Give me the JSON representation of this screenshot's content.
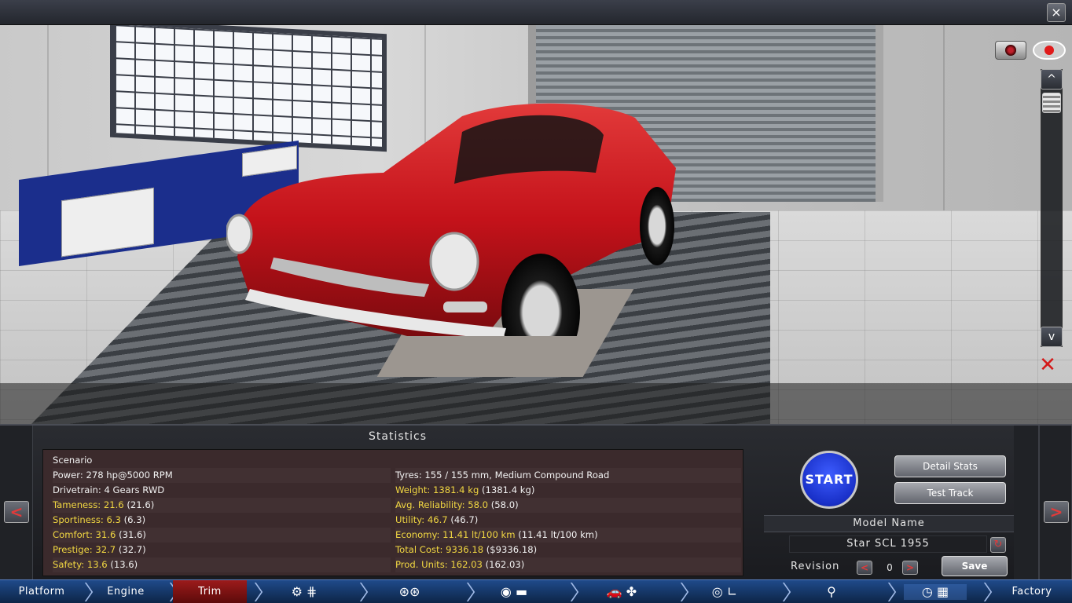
{
  "window": {
    "close_glyph": "×"
  },
  "scene": {
    "camera_icon": "camera-icon",
    "view_icon": "eye-icon",
    "scroll_up": "^",
    "scroll_down": "v",
    "hide_icon": "hide-view-icon"
  },
  "statistics": {
    "title": "Statistics",
    "left": [
      {
        "label": "Scenario",
        "paren": "",
        "color": "white"
      },
      {
        "label": "Power: 278 hp@5000 RPM",
        "paren": "",
        "color": "white"
      },
      {
        "label": "Drivetrain: 4 Gears RWD",
        "paren": "",
        "color": "white"
      },
      {
        "label": "Tameness: 21.6",
        "paren": "(21.6)",
        "color": "yellow"
      },
      {
        "label": "Sportiness: 6.3",
        "paren": "(6.3)",
        "color": "yellow"
      },
      {
        "label": "Comfort: 31.6",
        "paren": "(31.6)",
        "color": "yellow"
      },
      {
        "label": "Prestige: 32.7",
        "paren": "(32.7)",
        "color": "yellow"
      },
      {
        "label": "Safety: 13.6",
        "paren": "(13.6)",
        "color": "yellow"
      }
    ],
    "right": [
      {
        "label": "",
        "paren": "",
        "color": "white"
      },
      {
        "label": "Tyres: 155 / 155 mm, Medium Compound Road",
        "paren": "",
        "color": "white"
      },
      {
        "label": "Weight: 1381.4 kg",
        "paren": "(1381.4 kg)",
        "color": "yellow"
      },
      {
        "label": "Avg. Reliability: 58.0",
        "paren": "(58.0)",
        "color": "yellow"
      },
      {
        "label": "Utility: 46.7",
        "paren": "(46.7)",
        "color": "yellow"
      },
      {
        "label": "Economy: 11.41 lt/100 km",
        "paren": "(11.41 lt/100 km)",
        "color": "yellow"
      },
      {
        "label": "Total Cost: 9336.18",
        "paren": "($9336.18)",
        "color": "yellow"
      },
      {
        "label": "Prod. Units: 162.03",
        "paren": "(162.03)",
        "color": "yellow"
      }
    ]
  },
  "actions": {
    "start_label": "START",
    "detail_stats_label": "Detail Stats",
    "test_track_label": "Test Track",
    "model_name_title": "Model Name",
    "model_name_value": "Star SCL 1955",
    "revision_label": "Revision",
    "revision_value": "0",
    "prev_glyph": "<",
    "next_glyph": ">",
    "save_label": "Save"
  },
  "nav": {
    "prev_glyph": "<",
    "next_glyph": ">"
  },
  "tabs": [
    {
      "label": "Platform"
    },
    {
      "label": "Engine"
    },
    {
      "label": "Trim"
    },
    {
      "label": "Factory"
    }
  ],
  "colors": {
    "accent_yellow": "#f1d742",
    "start_blue": "#1930c8",
    "tab_active": "#9c1b1b",
    "arrow_red": "#e03b3b"
  }
}
